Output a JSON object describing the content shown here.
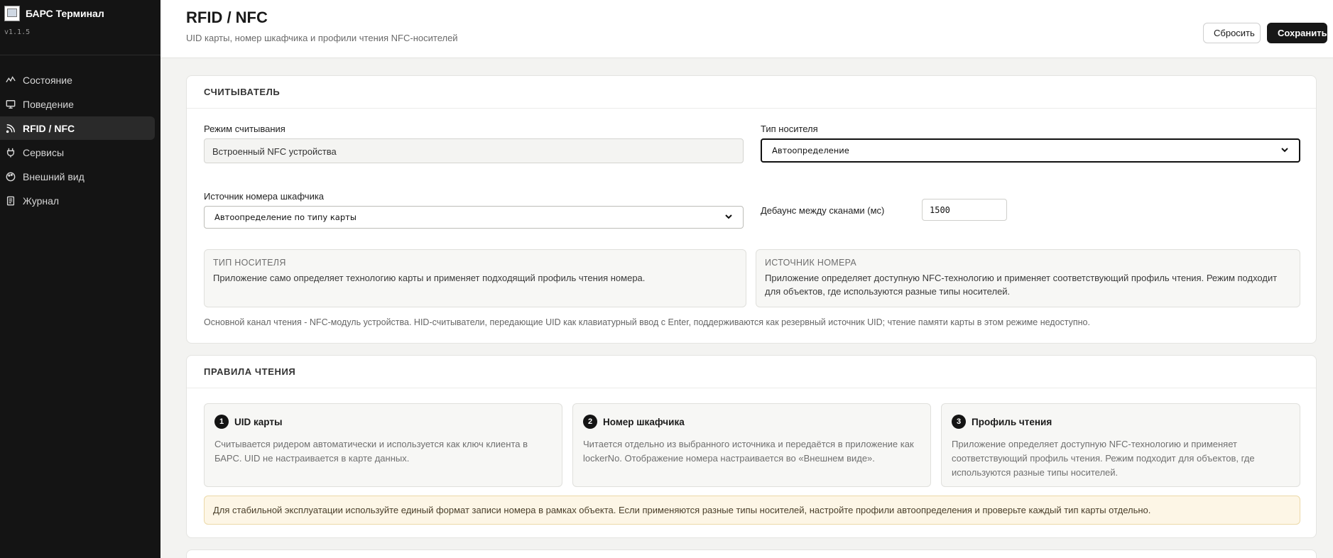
{
  "app": {
    "title": "БАРС Терминал",
    "version": "v1.1.5"
  },
  "sidebar": {
    "items": [
      {
        "label": "Состояние",
        "icon": "activity-icon",
        "active": false
      },
      {
        "label": "Поведение",
        "icon": "monitor-icon",
        "active": false
      },
      {
        "label": "RFID / NFC",
        "icon": "rss-icon",
        "active": true
      },
      {
        "label": "Сервисы",
        "icon": "plug-icon",
        "active": false
      },
      {
        "label": "Внешний вид",
        "icon": "palette-icon",
        "active": false
      },
      {
        "label": "Журнал",
        "icon": "file-text-icon",
        "active": false
      }
    ]
  },
  "header": {
    "title": "RFID / NFC",
    "subtitle": "UID карты, номер шкафчика и профили чтения NFC-носителей",
    "reset_label": "Сбросить",
    "save_label": "Сохранить"
  },
  "reader": {
    "heading": "СЧИТЫВАТЕЛЬ",
    "mode_label": "Режим считывания",
    "mode_value": "Встроенный NFC устройства",
    "media_type_label": "Тип носителя",
    "media_type_value": "Автоопределение",
    "locker_source_label": "Источник номера шкафчика",
    "locker_source_value": "Автоопределение по типу карты",
    "debounce_label": "Дебаунс между сканами (мс)",
    "debounce_value": "1500",
    "info_media_title": "ТИП НОСИТЕЛЯ",
    "info_media_text": "Приложение само определяет технологию карты и применяет подходящий профиль чтения номера.",
    "info_source_title": "ИСТОЧНИК НОМЕРА",
    "info_source_text": "Приложение определяет доступную NFC-технологию и применяет соответствующий профиль чтения. Режим подходит для объектов, где используются разные типы носителей.",
    "footnote": "Основной канал чтения - NFC-модуль устройства. HID-считыватели, передающие UID как клавиатурный ввод с Enter, поддерживаются как резервный источник UID; чтение памяти карты в этом режиме недоступно."
  },
  "rules": {
    "heading": "ПРАВИЛА ЧТЕНИЯ",
    "steps": [
      {
        "num": "1",
        "title": "UID карты",
        "text": "Считывается ридером автоматически и используется как ключ клиента в БАРС. UID не настраивается в карте данных."
      },
      {
        "num": "2",
        "title": "Номер шкафчика",
        "text": "Читается отдельно из выбранного источника и передаётся в приложение как lockerNo. Отображение номера настраивается во «Внешнем виде»."
      },
      {
        "num": "3",
        "title": "Профиль чтения",
        "text": "Приложение определяет доступную NFC-технологию и применяет соответствующий профиль чтения. Режим подходит для объектов, где используются разные типы носителей."
      }
    ],
    "warning": "Для стабильной эксплуатации используйте единый формат записи номера в рамках объекта. Если применяются разные типы носителей, настройте профили автоопределения и проверьте каждый тип карты отдельно."
  }
}
